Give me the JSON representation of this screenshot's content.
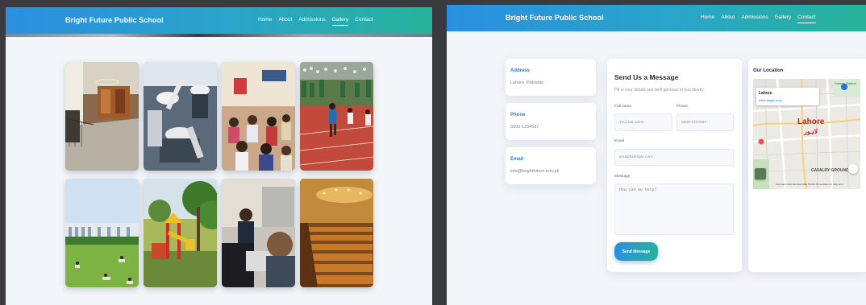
{
  "left_screen": {
    "brand": "Bright Future Public School",
    "nav": [
      "Home",
      "About",
      "Admissions",
      "Gallery",
      "Contact"
    ],
    "active_nav": "Gallery",
    "gallery": [
      {
        "icon": "library-hall-photo"
      },
      {
        "icon": "science-lab-microscopes-photo"
      },
      {
        "icon": "classroom-students-photo"
      },
      {
        "icon": "sports-day-track-photo"
      },
      {
        "icon": "campus-lawn-photo"
      },
      {
        "icon": "playground-photo"
      },
      {
        "icon": "students-in-class-photo"
      },
      {
        "icon": "auditorium-photo"
      }
    ]
  },
  "right_screen": {
    "brand": "Bright Future Public School",
    "nav": [
      "Home",
      "About",
      "Admissions",
      "Gallery",
      "Contact"
    ],
    "active_nav": "Contact",
    "contact_info": {
      "address": {
        "title": "Address",
        "value": "Lahore, Pakistan"
      },
      "phone": {
        "title": "Phone",
        "value": "0300-1234567"
      },
      "email": {
        "title": "Email",
        "value": "info@brightfuture.edu.pk"
      }
    },
    "form": {
      "title": "Send Us a Message",
      "subtitle": "Fill in your details and we'll get back to you shortly.",
      "full_name_label": "Full name",
      "full_name_placeholder": "Your full name",
      "phone_label": "Phone",
      "phone_placeholder": "0300-1234567",
      "email_label": "Email",
      "email_placeholder": "you@example.com",
      "message_label": "Message",
      "message_placeholder": "How can we help?",
      "submit_label": "Send Message"
    },
    "location": {
      "title": "Our Location",
      "place": "Lahore",
      "view_map": "View larger map",
      "city_label": "Lahore",
      "city_label_urdu": "لاہور",
      "fortress_label": "Fortress Stadium",
      "cavalry_label": "CAVALRY GROUND",
      "map_footer": "Keyboard shortcuts   Map data ©2025   Terms   Report a map error"
    }
  },
  "colors": {
    "nav_gradient_start": "#2a8fe0",
    "nav_gradient_end": "#27b39a",
    "accent_blue": "#2a7ee0",
    "page_bg": "#f2f5f9",
    "map_marker": "#c5221f"
  }
}
